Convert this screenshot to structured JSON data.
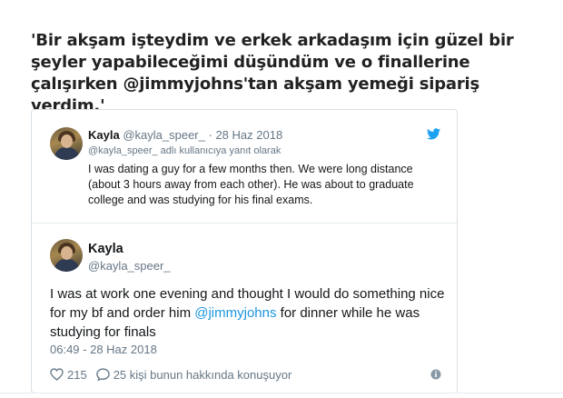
{
  "headline": "'Bir akşam işteydim ve erkek arkadaşım için güzel bir şeyler yapabileceğimi düşündüm ve o finallerine çalışırken @jimmyjohns'tan akşam yemeği sipariş verdim.'",
  "reply_tweet": {
    "name": "Kayla",
    "handle": "@kayla_speer_",
    "separator": "·",
    "date": "28 Haz 2018",
    "replying_to": "@kayla_speer_ adlı kullanıcıya yanıt olarak",
    "lines": [
      "I was dating a guy for a few months then. We were long distance",
      "(about 3 hours away from each other).  He was about to graduate",
      "college and was studying for his final exams."
    ]
  },
  "main_tweet": {
    "name": "Kayla",
    "handle": "@kayla_speer_",
    "text_before": "I was at work one evening and thought I would do something nice for my bf and order him ",
    "mention": "@jimmyjohns",
    "text_after": " for dinner while he was studying for finals",
    "timestamp": "06:49 - 28 Haz 2018",
    "likes": "215",
    "conversation": "25 kişi bunun hakkında konuşuyor"
  },
  "colors": {
    "link": "#1b95e0",
    "twitter_blue": "#1da1f2",
    "muted": "#657786",
    "border": "#d9dfe4"
  },
  "icons": [
    "twitter-bird-icon",
    "heart-icon",
    "comment-icon",
    "info-icon"
  ]
}
